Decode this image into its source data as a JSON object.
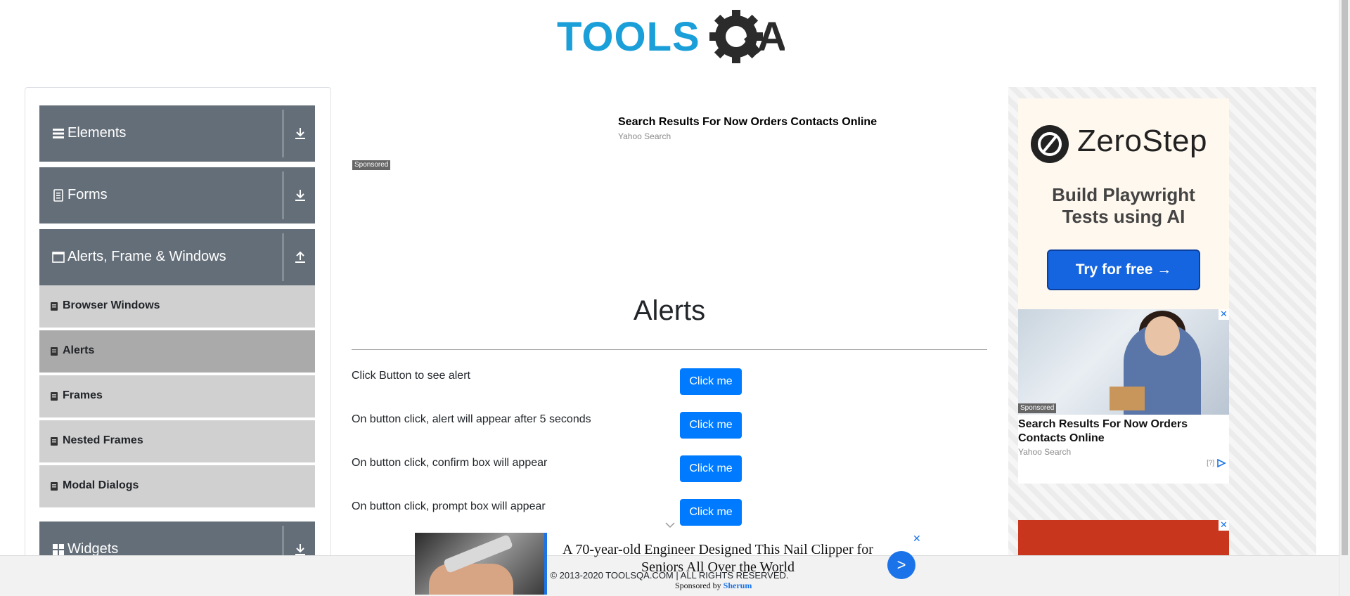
{
  "header": {
    "logo_text_left": "TOOLS",
    "logo_text_right": "A"
  },
  "sidebar": {
    "groups": [
      {
        "label": "Elements",
        "icon": "hamburger-icon",
        "toggle": "download-icon"
      },
      {
        "label": "Forms",
        "icon": "document-icon",
        "toggle": "download-icon"
      },
      {
        "label": "Alerts, Frame & Windows",
        "icon": "window-icon",
        "toggle": "upload-icon"
      },
      {
        "label": "Widgets",
        "icon": "grid-icon",
        "toggle": "download-icon"
      }
    ],
    "items": [
      {
        "label": "Browser Windows",
        "active": false
      },
      {
        "label": "Alerts",
        "active": true
      },
      {
        "label": "Frames",
        "active": false
      },
      {
        "label": "Nested Frames",
        "active": false
      },
      {
        "label": "Modal Dialogs",
        "active": false
      }
    ]
  },
  "top_ad": {
    "title": "Search Results For Now Orders Contacts Online",
    "source": "Yahoo Search",
    "sponsored": "Sponsored"
  },
  "main": {
    "title": "Alerts",
    "rows": [
      {
        "text": "Click Button to see alert",
        "button": "Click me"
      },
      {
        "text": "On button click, alert will appear after 5 seconds",
        "button": "Click me"
      },
      {
        "text": "On button click, confirm box will appear",
        "button": "Click me"
      },
      {
        "text": "On button click, prompt box will appear",
        "button": "Click me"
      }
    ]
  },
  "right_ads": {
    "zerostep": {
      "brand": "ZeroStep",
      "tagline_line1": "Build Playwright",
      "tagline_line2": "Tests using AI",
      "cta": "Try for free →"
    },
    "card": {
      "sponsored": "Sponsored",
      "title": "Search Results For Now Orders Contacts Online",
      "source": "Yahoo Search",
      "info": "[?]",
      "close": "✕"
    }
  },
  "footer": {
    "text": "© 2013-2020 TOOLSQA.COM | ALL RIGHTS RESERVED."
  },
  "sticky_ad": {
    "title": "A 70-year-old Engineer Designed This Nail Clipper for Seniors All Over the World",
    "sponsored_prefix": "Sponsored by ",
    "sponsor": "Sherum",
    "go": ">",
    "close": "✕"
  },
  "colors": {
    "group_header_bg": "#646e78",
    "menu_item_bg": "#d0d0d0",
    "menu_item_active_bg": "#aaaaaa",
    "primary_button": "#007bff",
    "logo_blue": "#1a9fd9",
    "logo_dark": "#2b2b2b"
  }
}
